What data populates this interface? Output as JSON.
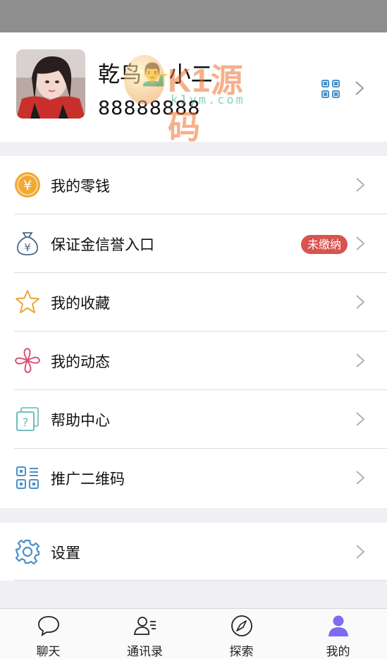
{
  "profile": {
    "nickname": "乾鸟💁‍♂️小二",
    "user_id": "88888888"
  },
  "watermark": {
    "brand": "K1源码",
    "url": "k1ym.com"
  },
  "menu": {
    "wallet": "我的零钱",
    "deposit": "保证金信誉入口",
    "deposit_badge": "未缴纳",
    "favorites": "我的收藏",
    "moments": "我的动态",
    "help": "帮助中心",
    "qrcode": "推广二维码",
    "settings": "设置"
  },
  "tabs": {
    "chat": "聊天",
    "contacts": "通讯录",
    "discover": "探索",
    "me": "我的"
  },
  "colors": {
    "accent": "#7b6cf0",
    "badge": "#d9534f",
    "coin": "#f2a933",
    "icon_blue": "#4a90c8"
  }
}
